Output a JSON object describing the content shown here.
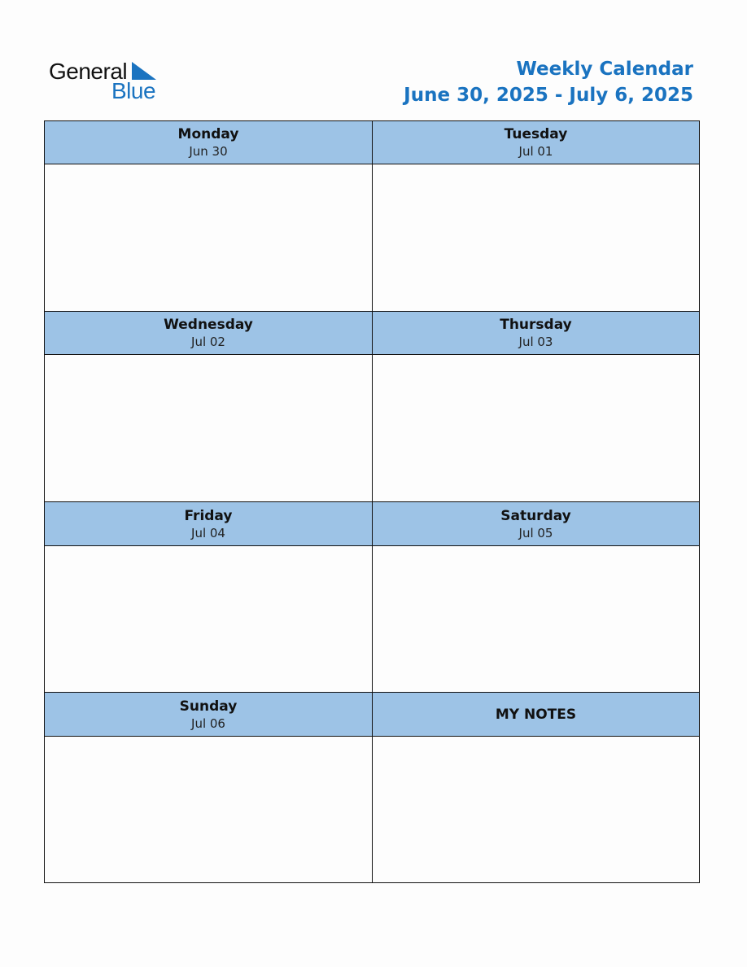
{
  "logo": {
    "word1": "General",
    "word2": "Blue",
    "icon": "triangle-logo-icon"
  },
  "header": {
    "title": "Weekly Calendar",
    "range": "June 30, 2025 - July 6, 2025"
  },
  "colors": {
    "brand_blue": "#1a73c0",
    "header_fill": "#9dc3e6",
    "border": "#111111"
  },
  "days": [
    {
      "name": "Monday",
      "date": "Jun 30"
    },
    {
      "name": "Tuesday",
      "date": "Jul 01"
    },
    {
      "name": "Wednesday",
      "date": "Jul 02"
    },
    {
      "name": "Thursday",
      "date": "Jul 03"
    },
    {
      "name": "Friday",
      "date": "Jul 04"
    },
    {
      "name": "Saturday",
      "date": "Jul 05"
    },
    {
      "name": "Sunday",
      "date": "Jul 06"
    }
  ],
  "notes": {
    "title": "MY NOTES"
  }
}
